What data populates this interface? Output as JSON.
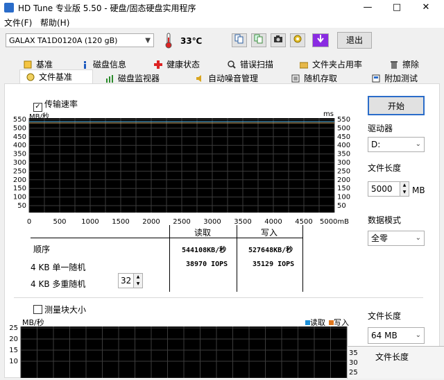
{
  "window": {
    "title": "HD Tune 专业版 5.50 - 硬盘/固态硬盘实用程序",
    "minimize": "—",
    "maximize": "□",
    "close": "✕"
  },
  "menu": [
    {
      "label": "文件(F)"
    },
    {
      "label": "帮助(H)"
    }
  ],
  "toolbar": {
    "drive": "GALAX TA1D0120A (120 gB)",
    "temperature": "33℃",
    "exit_label": "退出"
  },
  "tabs_row1": [
    {
      "label": "基准",
      "icon": "benchmark-icon"
    },
    {
      "label": "磁盘信息",
      "icon": "info-icon"
    },
    {
      "label": "健康状态",
      "icon": "health-icon"
    },
    {
      "label": "错误扫描",
      "icon": "scan-icon"
    },
    {
      "label": "文件夹占用率",
      "icon": "folder-icon"
    },
    {
      "label": "擦除",
      "icon": "erase-icon"
    }
  ],
  "tabs_row2": [
    {
      "label": "文件基准",
      "icon": "file-benchmark-icon",
      "active": true
    },
    {
      "label": "磁盘监视器",
      "icon": "monitor-icon"
    },
    {
      "label": "自动噪音管理",
      "icon": "speaker-icon"
    },
    {
      "label": "随机存取",
      "icon": "random-access-icon"
    },
    {
      "label": "附加测试",
      "icon": "extra-tests-icon"
    }
  ],
  "transfer": {
    "checkbox_label": "传输速率",
    "checked": true,
    "y_unit_left": "MB/秒",
    "y_unit_right": "ms",
    "y_ticks": [
      "550",
      "500",
      "450",
      "400",
      "350",
      "300",
      "250",
      "200",
      "150",
      "100",
      "50"
    ],
    "x_ticks": [
      "0",
      "500",
      "1000",
      "1500",
      "2000",
      "2500",
      "3000",
      "3500",
      "4000",
      "4500",
      "5000mB"
    ]
  },
  "results": {
    "col_read": "读取",
    "col_write": "写入",
    "rows": [
      {
        "label": "顺序",
        "read": "544108KB/秒",
        "write": "527648KB/秒"
      },
      {
        "label": "4 KB 单一随机",
        "read": "38970 IOPS",
        "write": "35129 IOPS"
      },
      {
        "label": "4 KB 多重随机",
        "read": "",
        "write": ""
      }
    ],
    "queue_depth": "32"
  },
  "right_panel": {
    "start_label": "开始",
    "drive_label": "驱动器",
    "drive_value": "D:",
    "file_length_label": "文件长度",
    "file_length_value": "5000",
    "file_length_unit": "MB",
    "data_mode_label": "数据模式",
    "data_mode_value": "全零"
  },
  "block": {
    "checkbox_label": "测量块大小",
    "checked": false,
    "y_unit": "MB/秒",
    "legend_read": "读取",
    "legend_write": "写入",
    "y_ticks": [
      "25",
      "20",
      "15",
      "10"
    ],
    "right_ticks": [
      "35",
      "30",
      "25"
    ],
    "file_length_label": "文件长度",
    "file_length_value": "64 MB",
    "overlay_label": "文件长度"
  },
  "colors": {
    "read_legend": "#1e90d8",
    "write_legend": "#e07820",
    "chart_bg": "#000000",
    "grid": "#3c3c3c"
  }
}
